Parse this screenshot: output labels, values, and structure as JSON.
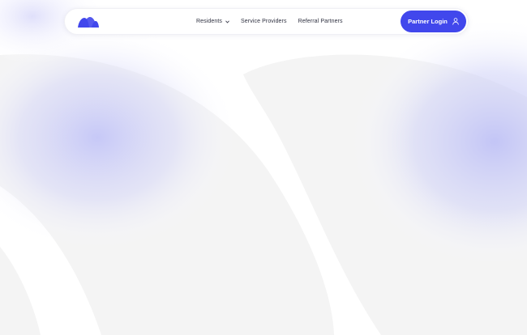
{
  "header": {
    "logo_icon": "wave-logo-icon",
    "nav": [
      {
        "label": "Residents",
        "icon": "chevron-down-icon"
      },
      {
        "label": "Service Providers"
      },
      {
        "label": "Referral Partners"
      }
    ],
    "cta": {
      "label": "Partner Login",
      "icon": "user-icon"
    }
  },
  "colors": {
    "accent": "#4147ec",
    "glow": "#c4c6f7",
    "background_shape": "#f4f4f4",
    "text": "#2f3140"
  }
}
